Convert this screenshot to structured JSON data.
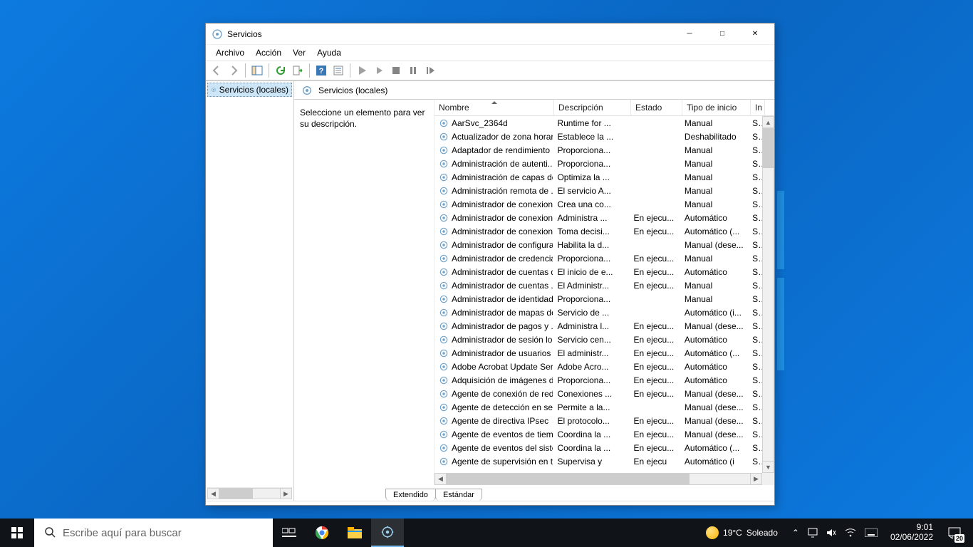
{
  "window": {
    "title": "Servicios",
    "menus": [
      "Archivo",
      "Acción",
      "Ver",
      "Ayuda"
    ]
  },
  "tree": {
    "root_label": "Servicios (locales)"
  },
  "pane": {
    "heading": "Servicios (locales)",
    "instruction": "Seleccione un elemento para ver su descripción."
  },
  "columns": {
    "name": "Nombre",
    "desc": "Descripción",
    "status": "Estado",
    "start": "Tipo de inicio",
    "logon": "In"
  },
  "services": [
    {
      "name": "AarSvc_2364d",
      "desc": "Runtime for ...",
      "status": "",
      "start": "Manual",
      "logon": "Sis"
    },
    {
      "name": "Actualizador de zona horari...",
      "desc": "Establece la ...",
      "status": "",
      "start": "Deshabilitado",
      "logon": "Se"
    },
    {
      "name": "Adaptador de rendimiento ...",
      "desc": "Proporciona...",
      "status": "",
      "start": "Manual",
      "logon": "Sis"
    },
    {
      "name": "Administración de autenti...",
      "desc": "Proporciona...",
      "status": "",
      "start": "Manual",
      "logon": "Sis"
    },
    {
      "name": "Administración de capas de...",
      "desc": "Optimiza la ...",
      "status": "",
      "start": "Manual",
      "logon": "Sis"
    },
    {
      "name": "Administración remota de ...",
      "desc": "El servicio A...",
      "status": "",
      "start": "Manual",
      "logon": "Se"
    },
    {
      "name": "Administrador de conexion...",
      "desc": "Crea una co...",
      "status": "",
      "start": "Manual",
      "logon": "Sis"
    },
    {
      "name": "Administrador de conexion...",
      "desc": "Administra ...",
      "status": "En ejecu...",
      "start": "Automático",
      "logon": "Sis"
    },
    {
      "name": "Administrador de conexion...",
      "desc": "Toma decisi...",
      "status": "En ejecu...",
      "start": "Automático (...",
      "logon": "Se"
    },
    {
      "name": "Administrador de configura...",
      "desc": "Habilita la d...",
      "status": "",
      "start": "Manual (dese...",
      "logon": "Sis"
    },
    {
      "name": "Administrador de credencia...",
      "desc": "Proporciona...",
      "status": "En ejecu...",
      "start": "Manual",
      "logon": "Sis"
    },
    {
      "name": "Administrador de cuentas d...",
      "desc": "El inicio de e...",
      "status": "En ejecu...",
      "start": "Automático",
      "logon": "Sis"
    },
    {
      "name": "Administrador de cuentas ...",
      "desc": "El Administr...",
      "status": "En ejecu...",
      "start": "Manual",
      "logon": "Sis"
    },
    {
      "name": "Administrador de identidad...",
      "desc": "Proporciona...",
      "status": "",
      "start": "Manual",
      "logon": "Se"
    },
    {
      "name": "Administrador de mapas de...",
      "desc": "Servicio de ...",
      "status": "",
      "start": "Automático (i...",
      "logon": "Se"
    },
    {
      "name": "Administrador de pagos y ...",
      "desc": "Administra l...",
      "status": "En ejecu...",
      "start": "Manual (dese...",
      "logon": "Sis"
    },
    {
      "name": "Administrador de sesión local",
      "desc": "Servicio cen...",
      "status": "En ejecu...",
      "start": "Automático",
      "logon": "Sis"
    },
    {
      "name": "Administrador de usuarios",
      "desc": "El administr...",
      "status": "En ejecu...",
      "start": "Automático (...",
      "logon": "Sis"
    },
    {
      "name": "Adobe Acrobat Update Serv...",
      "desc": "Adobe Acro...",
      "status": "En ejecu...",
      "start": "Automático",
      "logon": "Sis"
    },
    {
      "name": "Adquisición de imágenes d...",
      "desc": "Proporciona...",
      "status": "En ejecu...",
      "start": "Automático",
      "logon": "Se"
    },
    {
      "name": "Agente de conexión de red",
      "desc": "Conexiones ...",
      "status": "En ejecu...",
      "start": "Manual (dese...",
      "logon": "Sis"
    },
    {
      "name": "Agente de detección en seg...",
      "desc": "Permite a la...",
      "status": "",
      "start": "Manual (dese...",
      "logon": "Sis"
    },
    {
      "name": "Agente de directiva IPsec",
      "desc": "El protocolo...",
      "status": "En ejecu...",
      "start": "Manual (dese...",
      "logon": "Se"
    },
    {
      "name": "Agente de eventos de tiempo",
      "desc": "Coordina la ...",
      "status": "En ejecu...",
      "start": "Manual (dese...",
      "logon": "Se"
    },
    {
      "name": "Agente de eventos del siste...",
      "desc": "Coordina la ...",
      "status": "En ejecu...",
      "start": "Automático (...",
      "logon": "Sis"
    },
    {
      "name": "Agente de supervisión en ti",
      "desc": "Supervisa y",
      "status": "En ejecu",
      "start": "Automático (i",
      "logon": "Sis"
    }
  ],
  "tabs": {
    "extended": "Extendido",
    "standard": "Estándar"
  },
  "taskbar": {
    "search_placeholder": "Escribe aquí para buscar",
    "weather": {
      "temp": "19°C",
      "text": "Soleado"
    },
    "clock": {
      "time": "9:01",
      "date": "02/06/2022"
    },
    "notif_count": "20"
  }
}
